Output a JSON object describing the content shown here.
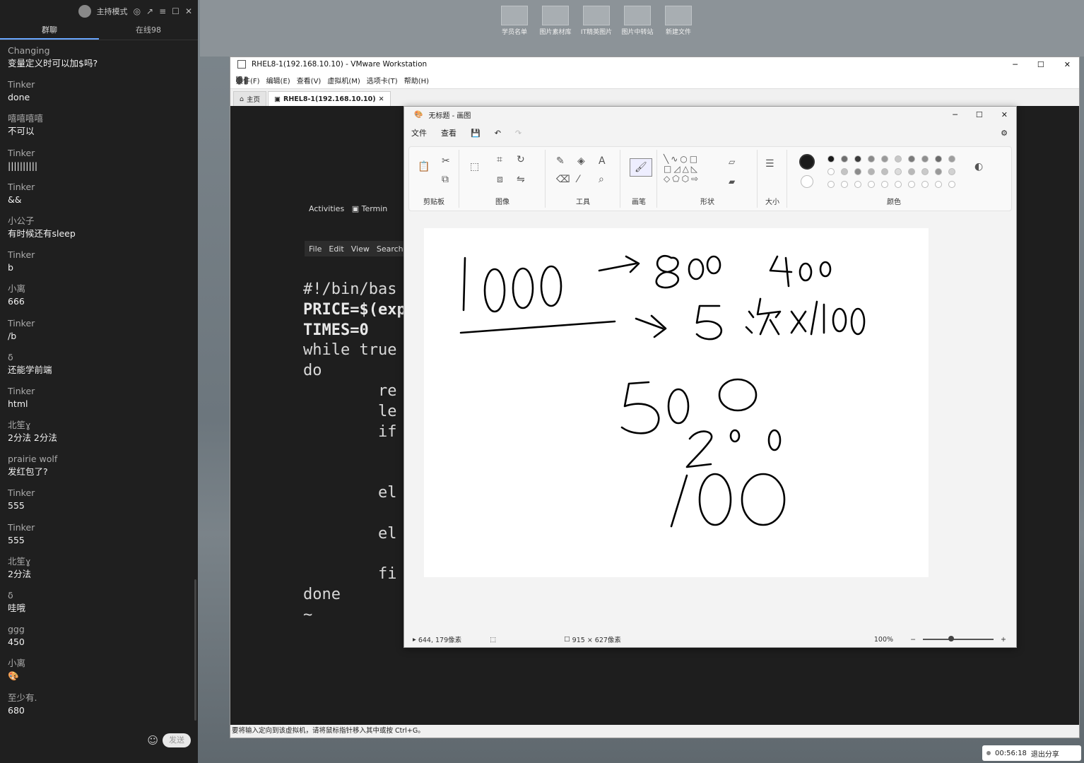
{
  "chat": {
    "title": "主持模式",
    "tabs": [
      "群聊",
      "在线98"
    ],
    "messages": [
      {
        "user": "Changing",
        "text": "变量定义时可以加$吗?"
      },
      {
        "user": "Tinker",
        "text": "done"
      },
      {
        "user": "嘻嘻嘻嘻",
        "text": "不可以"
      },
      {
        "user": "Tinker",
        "text": "||||||||||"
      },
      {
        "user": "Tinker",
        "text": "&&"
      },
      {
        "user": "小公子",
        "text": "有时候还有sleep"
      },
      {
        "user": "Tinker",
        "text": "b"
      },
      {
        "user": "小离",
        "text": "666"
      },
      {
        "user": "Tinker",
        "text": "/b"
      },
      {
        "user": "δ",
        "text": "还能学前端"
      },
      {
        "user": "Tinker",
        "text": "html"
      },
      {
        "user": "北笙ɣ",
        "text": "2分法 2分法"
      },
      {
        "user": "prairie wolf",
        "text": "发红包了?"
      },
      {
        "user": "Tinker",
        "text": "555"
      },
      {
        "user": "Tinker",
        "text": "555"
      },
      {
        "user": "北笙ɣ",
        "text": "2分法"
      },
      {
        "user": "δ",
        "text": "哇哦"
      },
      {
        "user": "ggg",
        "text": "450"
      },
      {
        "user": "小离",
        "text": "🎨"
      },
      {
        "user": "至少有.",
        "text": "680"
      }
    ],
    "send_label": "发送"
  },
  "desktop_icons": [
    "学员名单",
    "图片素材库",
    "IT精英图片",
    "图片中转站",
    "新建文件"
  ],
  "vmware": {
    "title": "RHEL8-1(192.168.10.10) - VMware Workstation",
    "menus": [
      "文件(F)",
      "编辑(E)",
      "查看(V)",
      "虚拟机(M)",
      "选项卡(T)",
      "帮助(H)"
    ],
    "tabs": [
      "主页",
      "RHEL8-1(192.168.10.10)"
    ],
    "status": "要将输入定向到该虚拟机，请将鼠标指针移入其中或按 Ctrl+G。",
    "guest": {
      "activities": "Activities",
      "terminal": "Termin",
      "terminal_menu": [
        "File",
        "Edit",
        "View",
        "Search"
      ],
      "code_lines": [
        "#!/bin/bas",
        "PRICE=$(exp",
        "TIMES=0",
        "while true",
        "do",
        "        re",
        "        le",
        "        if",
        "",
        "",
        "        el",
        "",
        "        el",
        "",
        "        fi",
        "done",
        "~"
      ]
    }
  },
  "paint": {
    "title": "无标题 - 画图",
    "menus": [
      "文件",
      "查看"
    ],
    "groups": [
      "剪贴板",
      "图像",
      "工具",
      "画笔",
      "形状",
      "大小",
      "颜色"
    ],
    "status_pos": "644, 179像素",
    "status_size": "915 × 627像素",
    "zoom": "100%",
    "canvas_text": [
      "1000 → 800  400",
      "→ 5 次 X/100",
      "500",
      "200",
      "100"
    ],
    "colors": {
      "primary": "#1a1a1a",
      "secondary": "#ffffff",
      "palette_row1": [
        "#1a1a1a",
        "#6e6e6e",
        "#3a3a3a",
        "#8a8a8a",
        "#9a9a9a",
        "#c8c8c8",
        "#7a7a7a",
        "#8f8f8f",
        "#6a6a6a",
        "#9e9e9e"
      ],
      "palette_row2": [
        "#ffffff",
        "#c4c4c4",
        "#8c8c8c",
        "#b4b4b4",
        "#c0c0c0",
        "#dcdcdc",
        "#b8b8b8",
        "#cacaca",
        "#9a9a9a",
        "#d2d2d2"
      ]
    }
  },
  "share": {
    "time": "00:56:18",
    "exit_label": "退出分享"
  }
}
